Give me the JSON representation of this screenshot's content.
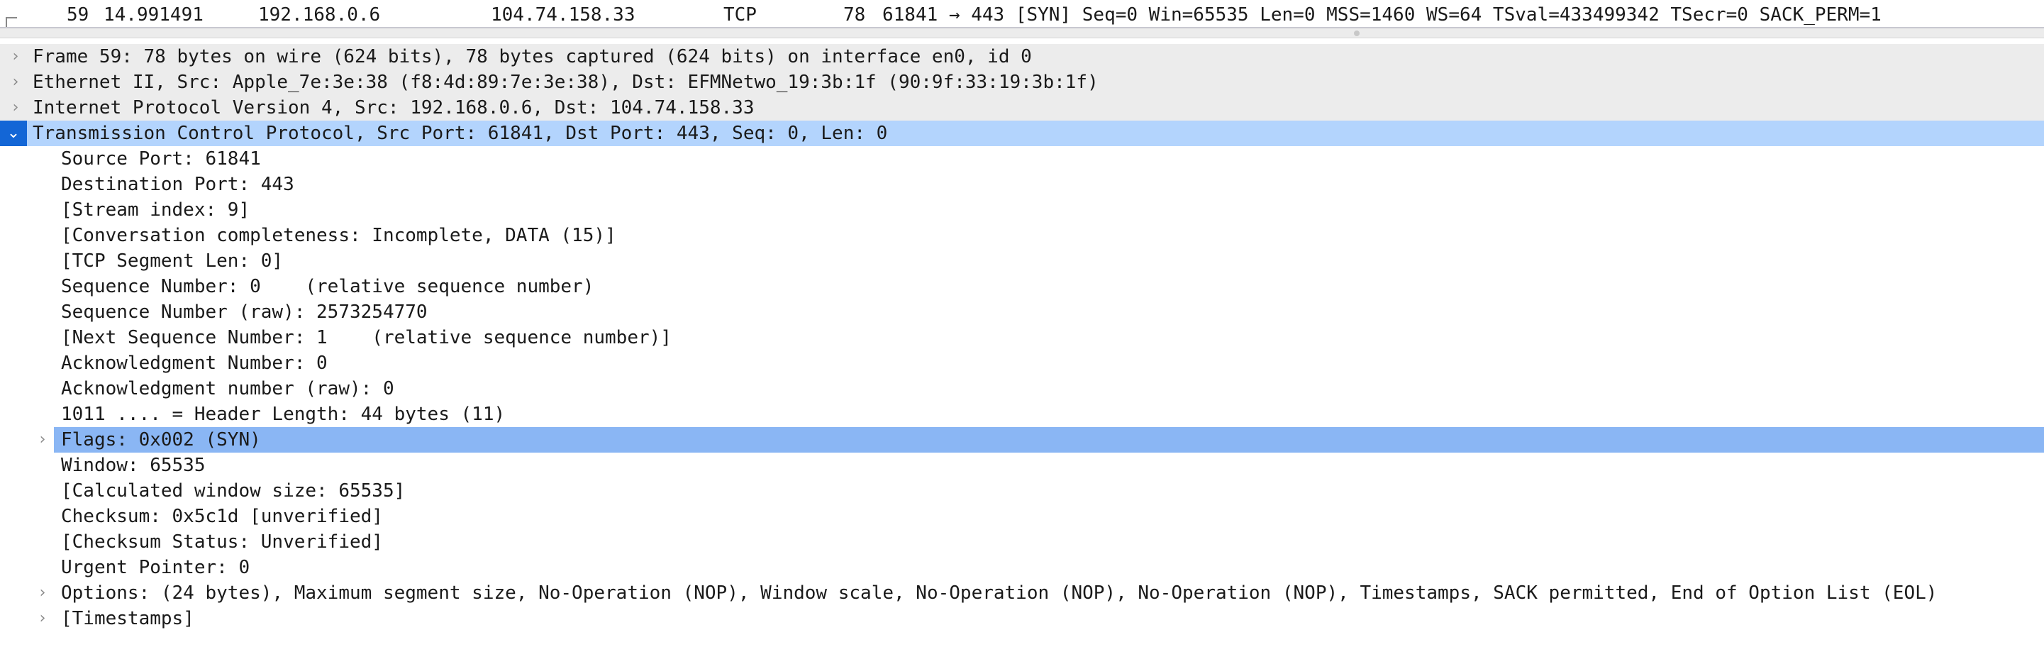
{
  "packet_list": {
    "selected_row": {
      "no": "59",
      "time": "14.991491",
      "source": "192.168.0.6",
      "destination": "104.74.158.33",
      "protocol": "TCP",
      "length": "78",
      "info": "61841 → 443 [SYN] Seq=0 Win=65535 Len=0 MSS=1460 WS=64 TSval=433499342 TSecr=0 SACK_PERM=1"
    }
  },
  "details": {
    "frame": "Frame 59: 78 bytes on wire (624 bits), 78 bytes captured (624 bits) on interface en0, id 0",
    "ethernet": "Ethernet II, Src: Apple_7e:3e:38 (f8:4d:89:7e:3e:38), Dst: EFMNetwo_19:3b:1f (90:9f:33:19:3b:1f)",
    "ipv4": "Internet Protocol Version 4, Src: 192.168.0.6, Dst: 104.74.158.33",
    "tcp": "Transmission Control Protocol, Src Port: 61841, Dst Port: 443, Seq: 0, Len: 0",
    "tcp_fields": {
      "src_port": "Source Port: 61841",
      "dst_port": "Destination Port: 443",
      "stream_index": "[Stream index: 9]",
      "conversation": "[Conversation completeness: Incomplete, DATA (15)]",
      "segment_len": "[TCP Segment Len: 0]",
      "seq_num": "Sequence Number: 0    (relative sequence number)",
      "seq_raw": "Sequence Number (raw): 2573254770",
      "next_seq": "[Next Sequence Number: 1    (relative sequence number)]",
      "ack_num": "Acknowledgment Number: 0",
      "ack_raw": "Acknowledgment number (raw): 0",
      "header_len": "1011 .... = Header Length: 44 bytes (11)",
      "flags": "Flags: 0x002 (SYN)",
      "window": "Window: 65535",
      "calc_window": "[Calculated window size: 65535]",
      "checksum": "Checksum: 0x5c1d [unverified]",
      "checksum_status": "[Checksum Status: Unverified]",
      "urgent": "Urgent Pointer: 0",
      "options": "Options: (24 bytes), Maximum segment size, No-Operation (NOP), Window scale, No-Operation (NOP), No-Operation (NOP), Timestamps, SACK permitted, End of Option List (EOL)",
      "timestamps": "[Timestamps]"
    }
  },
  "icons": {
    "collapsed": "›",
    "expanded": "⌄"
  },
  "colors": {
    "selected_row": "#b3d4fd",
    "highlight_field": "#8ab6f4",
    "expand_toggle": "#1366d6",
    "top_level_bg": "#ececec"
  }
}
